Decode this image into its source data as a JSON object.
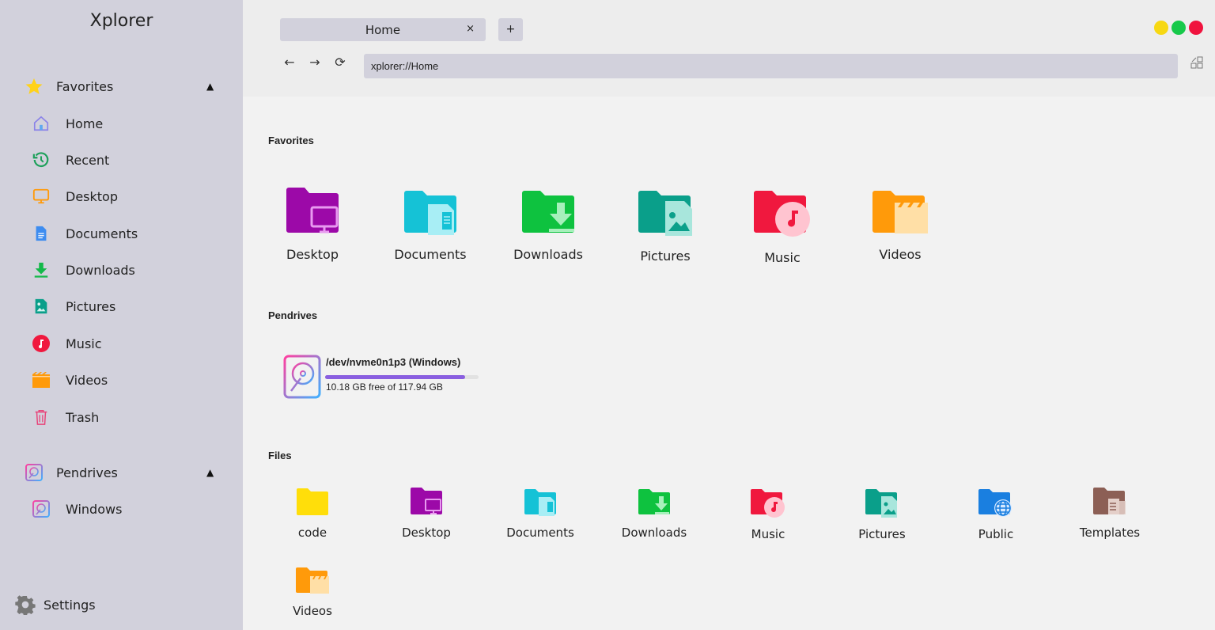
{
  "app_title": "Xplorer",
  "sidebar": {
    "favorites_header": "Favorites",
    "favorites": [
      {
        "label": "Home",
        "icon": "home-icon"
      },
      {
        "label": "Recent",
        "icon": "recent-icon"
      },
      {
        "label": "Desktop",
        "icon": "desktop-icon"
      },
      {
        "label": "Documents",
        "icon": "documents-icon"
      },
      {
        "label": "Downloads",
        "icon": "downloads-icon"
      },
      {
        "label": "Pictures",
        "icon": "pictures-icon"
      },
      {
        "label": "Music",
        "icon": "music-icon"
      },
      {
        "label": "Videos",
        "icon": "videos-icon"
      },
      {
        "label": "Trash",
        "icon": "trash-icon"
      }
    ],
    "pendrives_header": "Pendrives",
    "pendrives": [
      {
        "label": "Windows",
        "icon": "drive-icon"
      }
    ],
    "settings_label": "Settings",
    "caret": "▲"
  },
  "tabs": [
    {
      "label": "Home",
      "close": "×"
    }
  ],
  "new_tab_label": "+",
  "nav": {
    "back": "←",
    "forward": "→",
    "refresh": "⟳"
  },
  "address": "xplorer://Home",
  "window_controls": {
    "minimize_color": "#f7d812",
    "maximize_color": "#17c94a",
    "close_color": "#f0133e"
  },
  "main": {
    "favorites_title": "Favorites",
    "favorites": [
      {
        "label": "Desktop",
        "icon": "folder-desktop-icon",
        "color": "#9c09a8"
      },
      {
        "label": "Documents",
        "icon": "folder-documents-icon",
        "color": "#15c2d6"
      },
      {
        "label": "Downloads",
        "icon": "folder-downloads-icon",
        "color": "#0ec23f"
      },
      {
        "label": "Pictures",
        "icon": "folder-pictures-icon",
        "color": "#0a9f8a"
      },
      {
        "label": "Music",
        "icon": "folder-music-icon",
        "color": "#f0183e"
      },
      {
        "label": "Videos",
        "icon": "folder-videos-icon",
        "color": "#ff9a0a"
      }
    ],
    "pendrives_title": "Pendrives",
    "drive": {
      "name": "/dev/nvme0n1p3 (Windows)",
      "free_text": "10.18 GB free of 117.94 GB",
      "used_fraction": 0.914
    },
    "files_title": "Files",
    "files": [
      {
        "label": "code",
        "icon": "folder-icon",
        "color": "#ffde0a"
      },
      {
        "label": "Desktop",
        "icon": "folder-desktop-icon",
        "color": "#9c09a8"
      },
      {
        "label": "Documents",
        "icon": "folder-documents-icon",
        "color": "#15c2d6"
      },
      {
        "label": "Downloads",
        "icon": "folder-downloads-icon",
        "color": "#0ec23f"
      },
      {
        "label": "Music",
        "icon": "folder-music-icon",
        "color": "#f0183e"
      },
      {
        "label": "Pictures",
        "icon": "folder-pictures-icon",
        "color": "#0a9f8a"
      },
      {
        "label": "Public",
        "icon": "folder-public-icon",
        "color": "#1a7fe0"
      },
      {
        "label": "Templates",
        "icon": "folder-templates-icon",
        "color": "#8c5f55"
      },
      {
        "label": "Videos",
        "icon": "folder-videos-icon",
        "color": "#ff9a0a"
      }
    ]
  }
}
